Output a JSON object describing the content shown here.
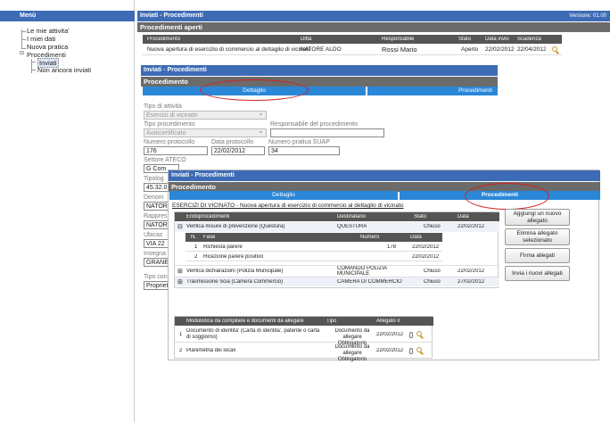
{
  "sidebar": {
    "title": "Menù",
    "items": [
      {
        "label": "Le mie attivita'"
      },
      {
        "label": "I miei dati"
      },
      {
        "label": "Nuova pratica"
      },
      {
        "label": "Procedimenti"
      },
      {
        "label": "Inviati"
      },
      {
        "label": "Non ancora inviati"
      }
    ]
  },
  "window1": {
    "title": "Inviati - Procedimenti",
    "version": "Versione: 01.00",
    "section": "Procedimenti aperti",
    "columns": [
      "Procedimento",
      "Ditta",
      "Responsabile",
      "Stato",
      "Data invio",
      "Scadenza"
    ],
    "rows": [
      [
        "Nuova apertura di esercizio di commercio al dettaglio di vicinato",
        "NATORE ALDO",
        "Rossi Mario",
        "Aperto",
        "22/02/2012",
        "22/04/2012"
      ]
    ]
  },
  "window2": {
    "title": "Inviati - Procedimenti",
    "section": "Procedimento",
    "tabs": [
      "Dettaglio",
      "Procedimenti"
    ],
    "fields": {
      "tipo_attivita_label": "Tipo di attività",
      "tipo_attivita_value": "Esercizi di vicinato",
      "tipo_procedimento_label": "Tipo procedimento",
      "tipo_procedimento_value": "Autocertificato",
      "responsabile_label": "Responsabile del procedimento",
      "numero_protocollo_label": "Numero protocollo",
      "numero_protocollo_value": "176",
      "data_protocollo_label": "Data protocollo",
      "data_protocollo_value": "22/02/2012",
      "numero_pratica_label": "Numero pratica SUAP",
      "numero_pratica_value": "34",
      "settore_label": "Settore ATECO",
      "settore_value": "G Com",
      "tipologia_label": "Tipolog",
      "tipologia_value": "45.32.0",
      "denom_label": "Denom",
      "denom_value": "NATOR",
      "rappr_label": "Rappres",
      "rappr_value": "NATOR",
      "ubic_label": "Ubicaz",
      "ubic_value": "VIA 22",
      "insegna_label": "Insegna",
      "insegna_value": "GRANE",
      "tipo_con_label": "Tipo con",
      "tipo_con_value": "Propriet"
    }
  },
  "window3": {
    "title": "Inviati - Procedimenti",
    "section": "Procedimento",
    "tabs": [
      "Dettaglio",
      "Procedimenti"
    ],
    "heading": "ESERCIZI DI VICINATO - Nuova apertura di esercizio di commercio al dettaglio di vicinato",
    "columns": [
      "Endoprocedimenti",
      "Destinatario",
      "Stato",
      "Data"
    ],
    "endoprocedimenti": [
      {
        "toggle": "⊟",
        "name": "Verifica misure di prevenzione (Questura)",
        "dest": "QUESTURA",
        "stato": "Chiuso",
        "data": "22/02/2012"
      },
      {
        "toggle": "⊞",
        "name": "Verifica dichiarazioni (Polizia Municipale)",
        "dest": "COMANDO POLIZIA MUNICIPALE",
        "stato": "Chiuso",
        "data": "22/02/2012"
      },
      {
        "toggle": "⊞",
        "name": "Trasmissione Scia (Camera Commercio)",
        "dest": "CAMERA DI COMMERCIO",
        "stato": "Chiuso",
        "data": "27/02/2012"
      }
    ],
    "fasi_columns": [
      "N.",
      "Fase",
      "Numero",
      "Data"
    ],
    "fasi": [
      {
        "n": "1",
        "fase": "Richiesta parere",
        "numero": "178",
        "data": "22/02/2012"
      },
      {
        "n": "2",
        "fase": "Ricezione parere positivo",
        "numero": "",
        "data": "22/02/2012"
      }
    ],
    "buttons": [
      "Aggiungi un nuovo allegato",
      "Elimina allegato selezionato",
      "Firma allegati",
      "Invia i nuovi allegati"
    ],
    "doc_columns": [
      "Modulistica da compilare e documenti da allegare",
      "Tipo",
      "Allegato il"
    ],
    "documents": [
      {
        "n": "1",
        "name": "Documento di identita' (Carta di identita', patente o carta di soggiorno)",
        "tipo": "Documento da allegare Obbligatorio",
        "date": "22/02/2012"
      },
      {
        "n": "2",
        "name": "Planimetria dei locali",
        "tipo": "Documento da allegare Obbligatorio",
        "date": "22/02/2012"
      }
    ]
  },
  "colors": {
    "header_blue": "#3d6bb5",
    "tab_blue": "#2a87d8",
    "section_gray": "#6b6b6b",
    "annotation_red": "#d42020"
  }
}
